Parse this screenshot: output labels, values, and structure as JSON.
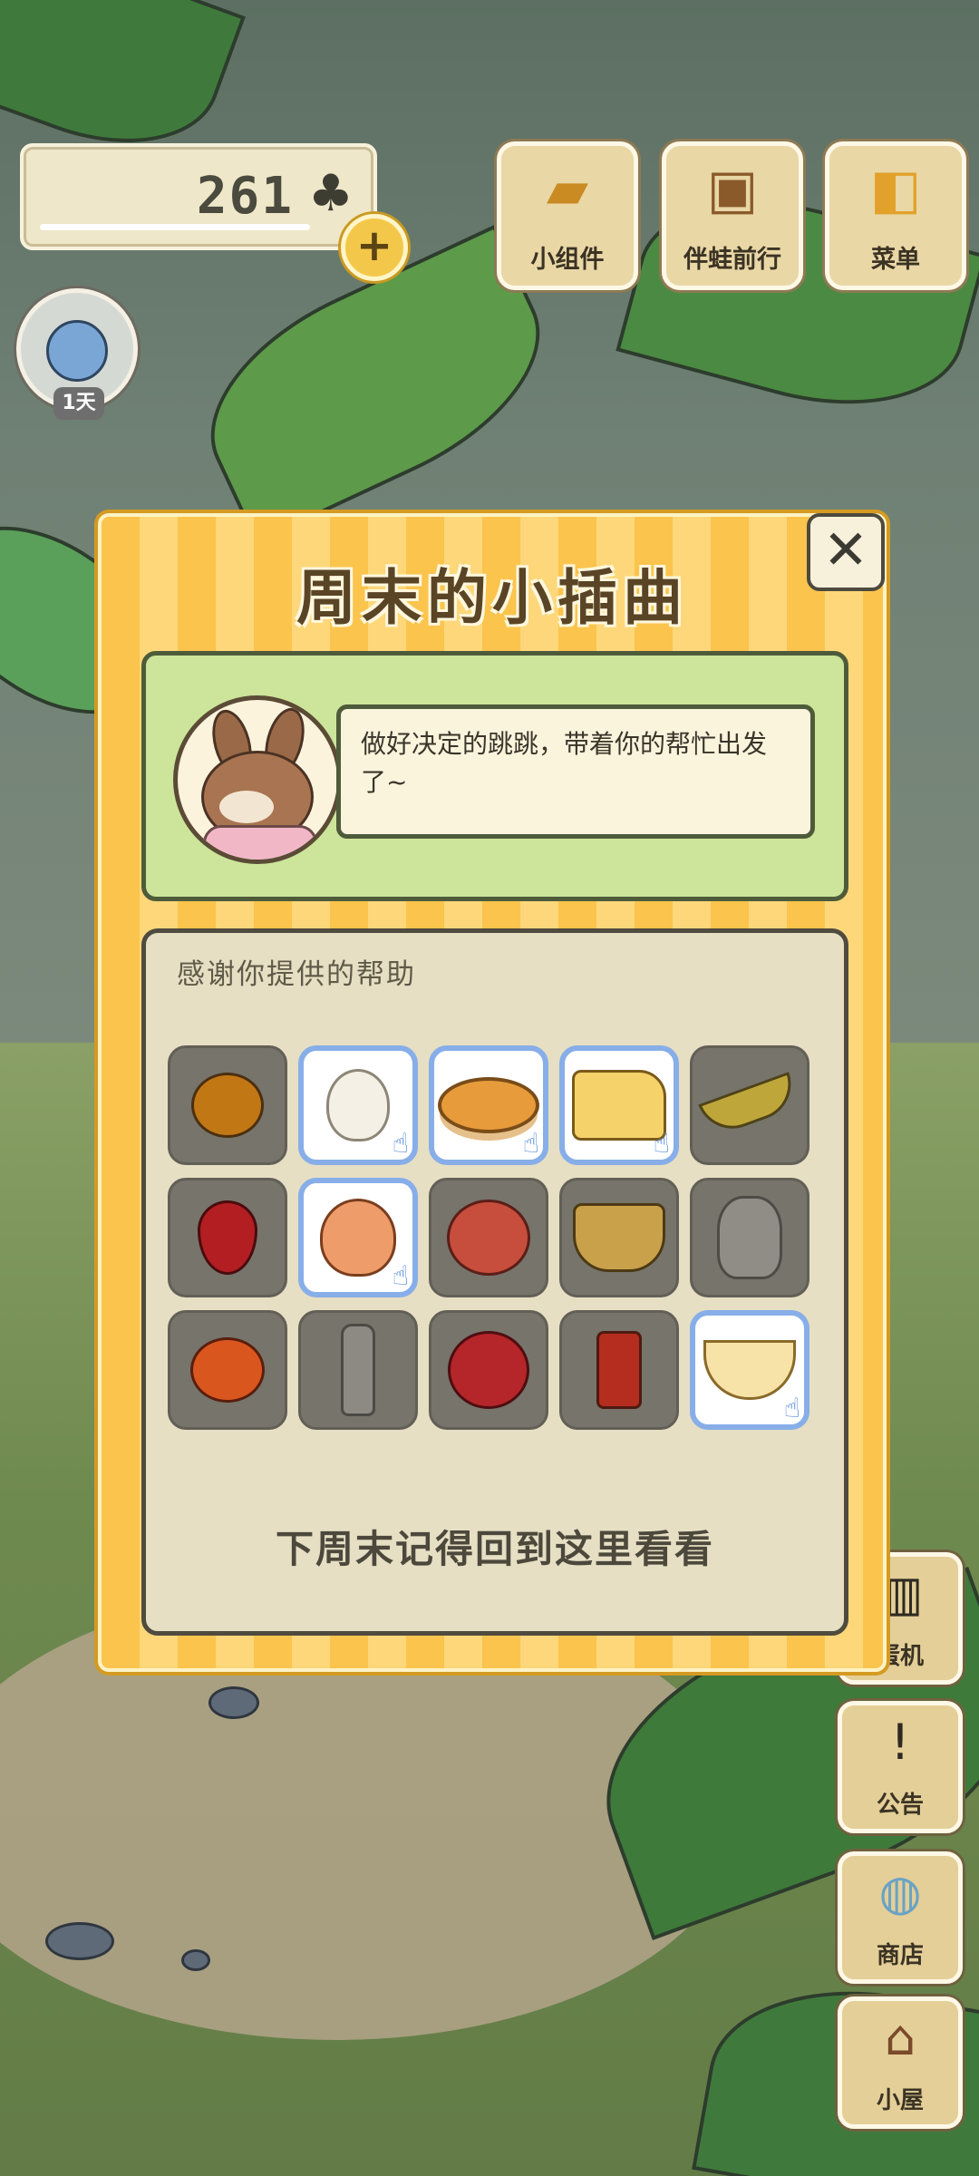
{
  "hud": {
    "clover_count": "261",
    "clover_icon": "♣",
    "plus_label": "+",
    "day_label": "1天"
  },
  "top_buttons": [
    {
      "id": "widgets",
      "label": "小组件",
      "icon": "widget-icon",
      "glyph": "▰"
    },
    {
      "id": "travel",
      "label": "伴蛙前行",
      "icon": "book-icon",
      "glyph": "▣"
    },
    {
      "id": "menu",
      "label": "菜单",
      "icon": "cards-icon",
      "glyph": "◧"
    }
  ],
  "side_buttons": [
    {
      "id": "gacha",
      "label": "蛋机",
      "icon": "gacha-machine-icon",
      "glyph": "▥"
    },
    {
      "id": "notice",
      "label": "公告",
      "icon": "exclamation-icon",
      "glyph": "!"
    },
    {
      "id": "shop",
      "label": "商店",
      "icon": "shop-bag-icon",
      "glyph": "◍"
    },
    {
      "id": "house",
      "label": "小屋",
      "icon": "house-icon",
      "glyph": "⌂"
    }
  ],
  "modal": {
    "title": "周末的小插曲",
    "close_label": "✕",
    "speech": "做好决定的跳跳，带着你的帮忙出发了~",
    "help_title": "感谢你提供的帮助",
    "footer": "下周末记得回到这里看看",
    "items": [
      {
        "name": "orange",
        "active": false
      },
      {
        "name": "garlic",
        "active": true
      },
      {
        "name": "cake",
        "active": true
      },
      {
        "name": "cheese",
        "active": true
      },
      {
        "name": "banana",
        "active": false
      },
      {
        "name": "strawberry",
        "active": false
      },
      {
        "name": "onion",
        "active": true
      },
      {
        "name": "peach",
        "active": false
      },
      {
        "name": "noodles",
        "active": false
      },
      {
        "name": "jug",
        "active": false
      },
      {
        "name": "mango",
        "active": false
      },
      {
        "name": "bottle",
        "active": false
      },
      {
        "name": "apple",
        "active": false
      },
      {
        "name": "can",
        "active": false
      },
      {
        "name": "teabowl",
        "active": true
      }
    ],
    "hand_glyph": "☝"
  },
  "colors": {
    "modal_stripe_a": "#fbc44d",
    "modal_stripe_b": "#fdd77a",
    "active_item_border": "#87aee8",
    "inactive_item_bg": "#76746b"
  }
}
